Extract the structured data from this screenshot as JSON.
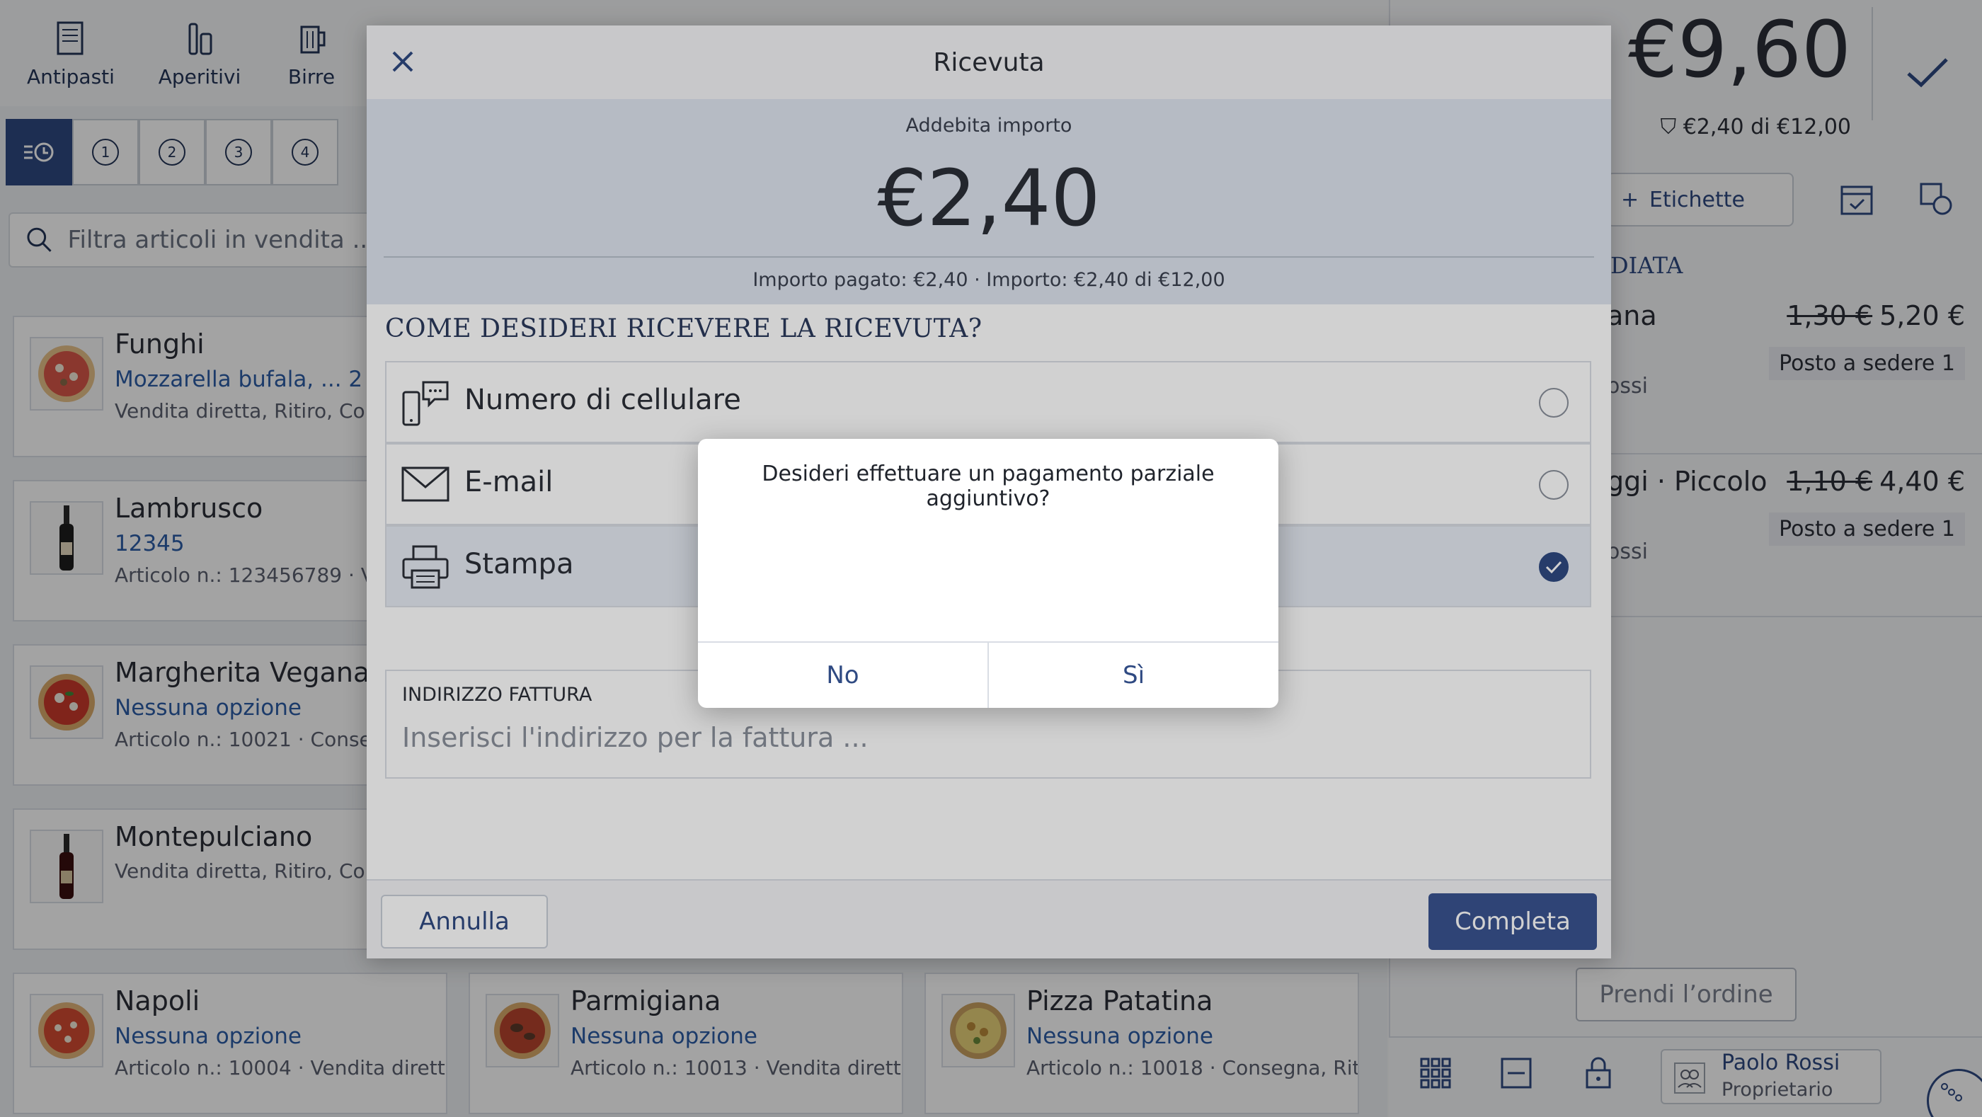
{
  "categories": [
    {
      "label": "Antipasti",
      "icon": "menu-card-icon"
    },
    {
      "label": "Aperitivi",
      "icon": "bottles-icon"
    },
    {
      "label": "Birre",
      "icon": "beer-mug-icon"
    }
  ],
  "seat_tabs": [
    "1",
    "2",
    "3",
    "4"
  ],
  "search": {
    "placeholder": "Filtra articoli in vendita ..."
  },
  "products": [
    {
      "name": "Funghi",
      "options": "Mozzarella bufala, ...  2 va",
      "meta": "Vendita diretta, Ritiro, Conse"
    },
    {
      "name": "Lambrusco",
      "options": "12345",
      "meta": "Articolo n.: 123456789 · Vend"
    },
    {
      "name": "Margherita Vegana",
      "options": "Nessuna opzione",
      "meta": "Articolo n.: 10021 · Consegna"
    },
    {
      "name": "Montepulciano",
      "options": "",
      "meta": "Vendita diretta, Ritiro, Conse"
    },
    {
      "name": "Napoli",
      "options": "Nessuna opzione",
      "meta": "Articolo n.: 10004 · Vendita dirett..."
    },
    {
      "name": "Parmigiana",
      "options": "Nessuna opzione",
      "meta": "Articolo n.: 10013 · Vendita dirett..."
    },
    {
      "name": "Pizza Patatina",
      "options": "Nessuna opzione",
      "meta": "Articolo n.: 10018 · Consegna, Rit..."
    }
  ],
  "order": {
    "total": "€9,60",
    "voucher_info": "€2,40  di  €12,00",
    "tags_button": "Etichette",
    "section_label": "DIATA",
    "lines": [
      {
        "name": "ana",
        "old_price": "1,30 €",
        "price": "5,20 €",
        "seat": "Posto a sedere 1",
        "owner": "ossi"
      },
      {
        "name": "ggi · Piccolo",
        "old_price": "1,10 €",
        "price": "4,40 €",
        "seat": "Posto a sedere 1",
        "owner": "ossi"
      }
    ],
    "take_order_button": "Prendi l’ordine",
    "user": {
      "name": "Paolo Rossi",
      "role": "Proprietario"
    }
  },
  "receipt_modal": {
    "title": "Ricevuta",
    "charge_label": "Addebita importo",
    "charge_amount": "€2,40",
    "summary": "Importo pagato: €2,40 · Importo: €2,40 di €12,00",
    "question": "COME DESIDERI RICEVERE LA RICEVUTA?",
    "options": [
      {
        "label": "Numero di cellulare",
        "icon": "mobile-phone-icon",
        "selected": false
      },
      {
        "label": "E-mail",
        "icon": "envelope-icon",
        "selected": false
      },
      {
        "label": "Stampa",
        "icon": "printer-icon",
        "selected": true
      }
    ],
    "address_label": "INDIRIZZO FATTURA",
    "address_placeholder": "Inserisci l'indirizzo per la fattura ...",
    "cancel_button": "Annulla",
    "complete_button": "Completa"
  },
  "confirm_dialog": {
    "message": "Desideri effettuare un pagamento parziale aggiuntivo?",
    "no_button": "No",
    "yes_button": "Sì"
  },
  "colors": {
    "primary": "#2f4a82",
    "accent_text": "#2e5ea7",
    "selected_bg": "#e6ebf3"
  }
}
